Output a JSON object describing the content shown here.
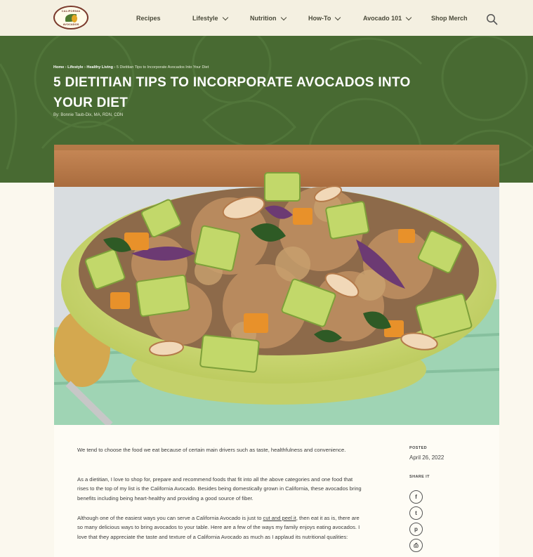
{
  "logo": {
    "top_text": "CALIFORNIA",
    "bottom_text": "AVOCADOS"
  },
  "nav": {
    "items": [
      {
        "label": "Recipes",
        "has_dropdown": false
      },
      {
        "label": "Lifestyle",
        "has_dropdown": true
      },
      {
        "label": "Nutrition",
        "has_dropdown": true
      },
      {
        "label": "How-To",
        "has_dropdown": true
      },
      {
        "label": "Avocado 101",
        "has_dropdown": true
      },
      {
        "label": "Shop Merch",
        "has_dropdown": false
      }
    ],
    "search_icon": "search-icon"
  },
  "breadcrumb": {
    "items": [
      "Home",
      "Lifestyle",
      "Healthy Living"
    ],
    "separator": " › ",
    "current": "5 Dietitian Tips to Incorporate Avocados Into Your Diet"
  },
  "article": {
    "title": "5 DIETITIAN TIPS TO INCORPORATE AVOCADOS INTO YOUR DIET",
    "byline": "By: Bonnie Taub-Dix, MA, RDN, CDN",
    "para1": "We tend to choose the food we eat because of certain main drivers such as taste, healthfulness and convenience.",
    "para2": "As a dietitian, I love to shop for, prepare and recommend foods that fit into all the above categories and one food that rises to the top of my list is the California Avocado. Besides being domestically grown in California, these avocados bring benefits including being heart-healthy and providing a good source of fiber.",
    "para3_before": "Although one of the easiest ways you can serve a California Avocado is just to ",
    "para3_link": "cut and peel it",
    "para3_after": ", then eat it as is, there are so many delicious ways to bring avocados to your table. Here are a few of the ways my family enjoys eating avocados. I love that they appreciate the taste and texture of a California Avocado as much as I applaud its nutritional qualities:"
  },
  "sidebar": {
    "posted_label": "POSTED",
    "posted_date": "April 26, 2022",
    "share_label": "SHARE IT",
    "share_icons": [
      "facebook-icon",
      "twitter-icon",
      "pinterest-icon",
      "print-icon"
    ],
    "share_glyphs": [
      "f",
      "t",
      "p",
      "⎙"
    ]
  },
  "colors": {
    "hero_green": "#486a32",
    "nav_bg": "#f4f0e1",
    "page_bg": "#fbf8ee"
  }
}
